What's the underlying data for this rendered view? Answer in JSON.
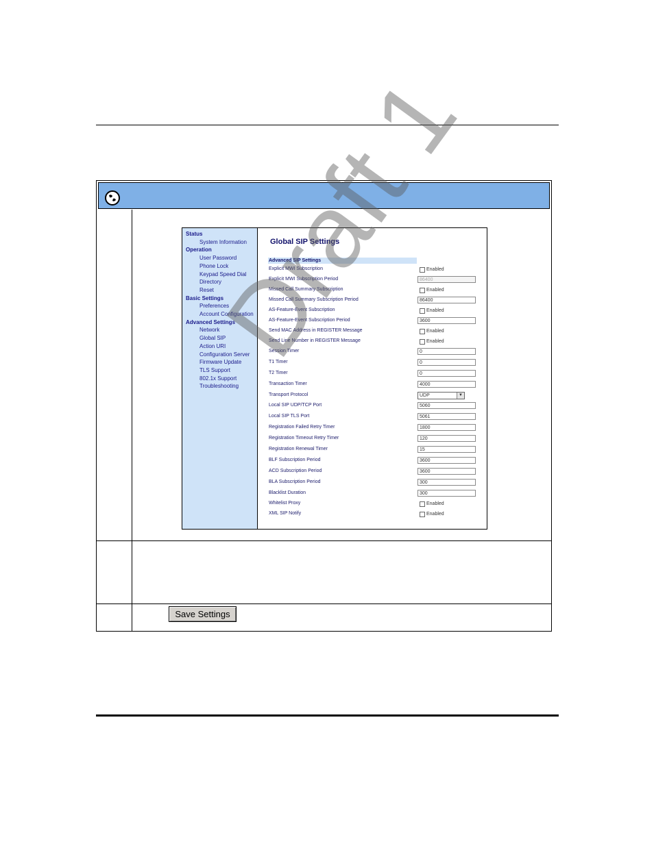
{
  "sidebar": {
    "sections": [
      {
        "label": "Status",
        "items": [
          "System Information"
        ]
      },
      {
        "label": "Operation",
        "items": [
          "User Password",
          "Phone Lock",
          "Keypad Speed Dial",
          "Directory",
          "Reset"
        ]
      },
      {
        "label": "Basic Settings",
        "items": [
          "Preferences",
          "Account Configuration"
        ]
      },
      {
        "label": "Advanced Settings",
        "items": [
          "Network",
          "Global SIP",
          "Action URI",
          "Configuration Server",
          "Firmware Update",
          "TLS Support",
          "802.1x Support",
          "Troubleshooting"
        ]
      }
    ]
  },
  "page_title": "Global SIP Settings",
  "section_header": "Advanced SIP Settings",
  "enabled_label": "Enabled",
  "rows": [
    {
      "label": "Explicit MWI Subscription",
      "kind": "checkbox"
    },
    {
      "label": "Explicit MWI Subscription Period",
      "kind": "input",
      "value": "86400",
      "disabled": true
    },
    {
      "label": "Missed Call Summary Subscription",
      "kind": "checkbox"
    },
    {
      "label": "Missed Call Summary Subscription Period",
      "kind": "input",
      "value": "86400"
    },
    {
      "label": "AS-Feature-Event Subscription",
      "kind": "checkbox"
    },
    {
      "label": "AS-Feature-Event Subscription Period",
      "kind": "input",
      "value": "3600"
    },
    {
      "label": "Send MAC Address in REGISTER Message",
      "kind": "checkbox"
    },
    {
      "label": "Send Line Number in REGISTER Message",
      "kind": "checkbox"
    },
    {
      "label": "Session Timer",
      "kind": "input",
      "value": "0"
    },
    {
      "label": "T1 Timer",
      "kind": "input",
      "value": "0"
    },
    {
      "label": "T2 Timer",
      "kind": "input",
      "value": "0"
    },
    {
      "label": "Transaction Timer",
      "kind": "input",
      "value": "4000"
    },
    {
      "label": "Transport Protocol",
      "kind": "select",
      "value": "UDP"
    },
    {
      "label": "Local SIP UDP/TCP Port",
      "kind": "input",
      "value": "5060"
    },
    {
      "label": "Local SIP TLS Port",
      "kind": "input",
      "value": "5061"
    },
    {
      "label": "Registration Failed Retry Timer",
      "kind": "input",
      "value": "1800"
    },
    {
      "label": "Registration Timeout Retry Timer",
      "kind": "input",
      "value": "120"
    },
    {
      "label": "Registration Renewal Timer",
      "kind": "input",
      "value": "15"
    },
    {
      "label": "BLF Subscription Period",
      "kind": "input",
      "value": "3600"
    },
    {
      "label": "ACD Subscription Period",
      "kind": "input",
      "value": "3600"
    },
    {
      "label": "BLA Subscription Period",
      "kind": "input",
      "value": "300"
    },
    {
      "label": "Blacklist Duration",
      "kind": "input",
      "value": "300"
    },
    {
      "label": "Whitelist Proxy",
      "kind": "checkbox"
    },
    {
      "label": "XML SIP Notify",
      "kind": "checkbox"
    }
  ],
  "save_button_label": "Save Settings",
  "watermark": "Draft 1",
  "colors": {
    "header_band": "#7fb0e6",
    "sidebar_bg": "#cfe3f8",
    "title_text": "#10106a"
  }
}
